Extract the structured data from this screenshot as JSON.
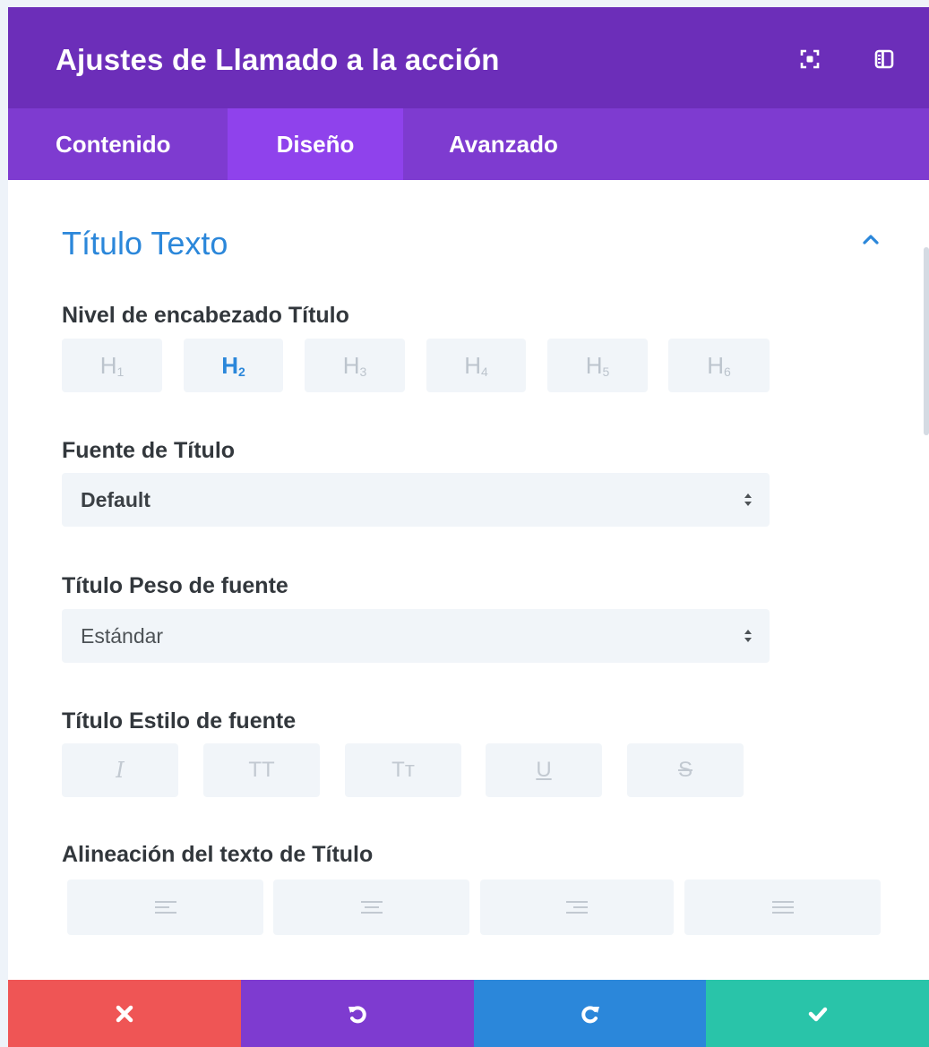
{
  "header": {
    "title": "Ajustes de Llamado a la acción",
    "icons": [
      "expand-icon",
      "sidebar-toggle-icon"
    ]
  },
  "tabs": [
    {
      "label": "Contenido",
      "active": false
    },
    {
      "label": "Diseño",
      "active": true
    },
    {
      "label": "Avanzado",
      "active": false
    }
  ],
  "section": {
    "title": "Título Texto",
    "expanded": true
  },
  "heading_level": {
    "label": "Nivel de encabezado Título",
    "options": [
      {
        "letter": "H",
        "sub": "1"
      },
      {
        "letter": "H",
        "sub": "2"
      },
      {
        "letter": "H",
        "sub": "3"
      },
      {
        "letter": "H",
        "sub": "4"
      },
      {
        "letter": "H",
        "sub": "5"
      },
      {
        "letter": "H",
        "sub": "6"
      }
    ],
    "selected": "H2"
  },
  "font": {
    "label": "Fuente de Título",
    "value": "Default"
  },
  "font_weight": {
    "label": "Título Peso de fuente",
    "value": "Estándar"
  },
  "font_style": {
    "label": "Título Estilo de fuente",
    "options": [
      {
        "glyph": "I",
        "name": "italic"
      },
      {
        "glyph": "TT",
        "name": "uppercase"
      },
      {
        "glyph": "Tт",
        "name": "capitalize"
      },
      {
        "glyph": "U",
        "name": "underline"
      },
      {
        "glyph": "S",
        "name": "strikethrough"
      }
    ]
  },
  "text_align": {
    "label": "Alineación del texto de Título",
    "options": [
      "left",
      "center",
      "right",
      "justify"
    ]
  },
  "footer": {
    "actions": [
      "cancel",
      "undo",
      "redo",
      "save"
    ],
    "colors": {
      "cancel": "#ef5555",
      "undo": "#7e3bd0",
      "redo": "#2b87da",
      "save": "#29c4a9"
    }
  },
  "colors": {
    "header": "#6c2eb9",
    "tabs": "#7e3bd0",
    "active_tab": "#8f42ec",
    "accent": "#2b87da"
  }
}
